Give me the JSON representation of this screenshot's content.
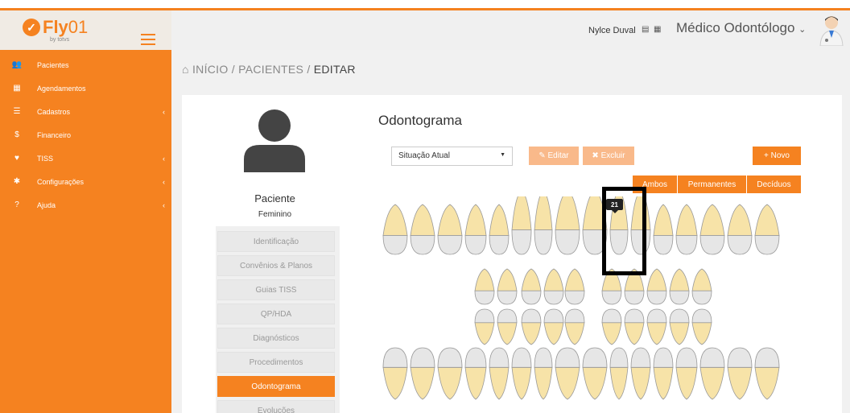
{
  "brand": {
    "name": "Fly",
    "version": "01",
    "sub": "by totvs"
  },
  "sidebar": {
    "items": [
      {
        "label": "Pacientes",
        "icon": "users-icon",
        "glyph": "👥",
        "has_children": false
      },
      {
        "label": "Agendamentos",
        "icon": "calendar-icon",
        "glyph": "▦",
        "has_children": false
      },
      {
        "label": "Cadastros",
        "icon": "list-icon",
        "glyph": "☰",
        "has_children": true
      },
      {
        "label": "Financeiro",
        "icon": "dollar-icon",
        "glyph": "$",
        "has_children": false
      },
      {
        "label": "TISS",
        "icon": "heartbeat-icon",
        "glyph": "♥",
        "has_children": true
      },
      {
        "label": "Configurações",
        "icon": "gear-icon",
        "glyph": "✱",
        "has_children": true
      },
      {
        "label": "Ajuda",
        "icon": "question-icon",
        "glyph": "?",
        "has_children": true
      }
    ]
  },
  "header": {
    "user_name": "Nylce Duval",
    "role": "Médico Odontólogo",
    "role_caret": "⌄"
  },
  "breadcrumb": {
    "home": "INÍCIO",
    "sep1": " / ",
    "section": "PACIENTES",
    "sep2": " / ",
    "current": "EDITAR"
  },
  "patient": {
    "name": "Paciente",
    "sex": "Feminino"
  },
  "patient_tabs": [
    {
      "label": "Identificação",
      "active": false
    },
    {
      "label": "Convênios & Planos",
      "active": false
    },
    {
      "label": "Guias TISS",
      "active": false
    },
    {
      "label": "QP/HDA",
      "active": false
    },
    {
      "label": "Diagnósticos",
      "active": false
    },
    {
      "label": "Procedimentos",
      "active": false
    },
    {
      "label": "Odontograma",
      "active": true
    },
    {
      "label": "Evoluções",
      "active": false
    }
  ],
  "odontograma": {
    "title": "Odontograma",
    "select_value": "Situação Atual",
    "edit_label": "Editar",
    "delete_label": "Excluir",
    "new_label": "Novo",
    "filters": [
      "Ambos",
      "Permanentes",
      "Decíduos"
    ],
    "selected_tooth": "21"
  },
  "colors": {
    "accent": "#f58220",
    "accent_light": "#f9b98a",
    "tooth_root": "#f7e3a8",
    "tooth_crown": "#e6e6e6"
  }
}
